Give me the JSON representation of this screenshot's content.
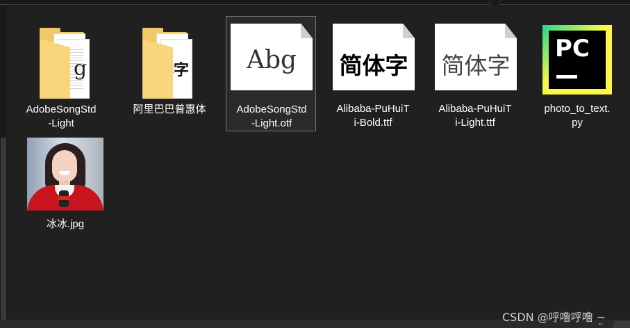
{
  "files": [
    {
      "label": "AdobeSongStd\n-Light",
      "kind": "folder",
      "preview": "g"
    },
    {
      "label": "阿里巴巴普惠体",
      "kind": "folder",
      "preview": "体字"
    },
    {
      "label": "AdobeSongStd\n-Light.otf",
      "kind": "font-file",
      "preview": "Abg",
      "selected": true
    },
    {
      "label": "Alibaba-PuHuiT\ni-Bold.ttf",
      "kind": "font-file",
      "preview": "简体字"
    },
    {
      "label": "Alibaba-PuHuiT\ni-Light.ttf",
      "kind": "font-file",
      "preview": "简体字"
    },
    {
      "label": "photo_to_text.\npy",
      "kind": "python-file",
      "preview": "PC"
    },
    {
      "label": "冰冰.jpg",
      "kind": "image-file",
      "preview": ""
    }
  ],
  "watermark": "CSDN @呼噜呼噜 ~",
  "icons": {
    "folder": "folder-icon",
    "font": "font-file-icon",
    "python": "pycharm-icon",
    "image": "image-thumbnail"
  },
  "colors": {
    "background": "#202020",
    "folder": "#f2c767",
    "text": "#ffffff",
    "selection_border": "#777777"
  }
}
